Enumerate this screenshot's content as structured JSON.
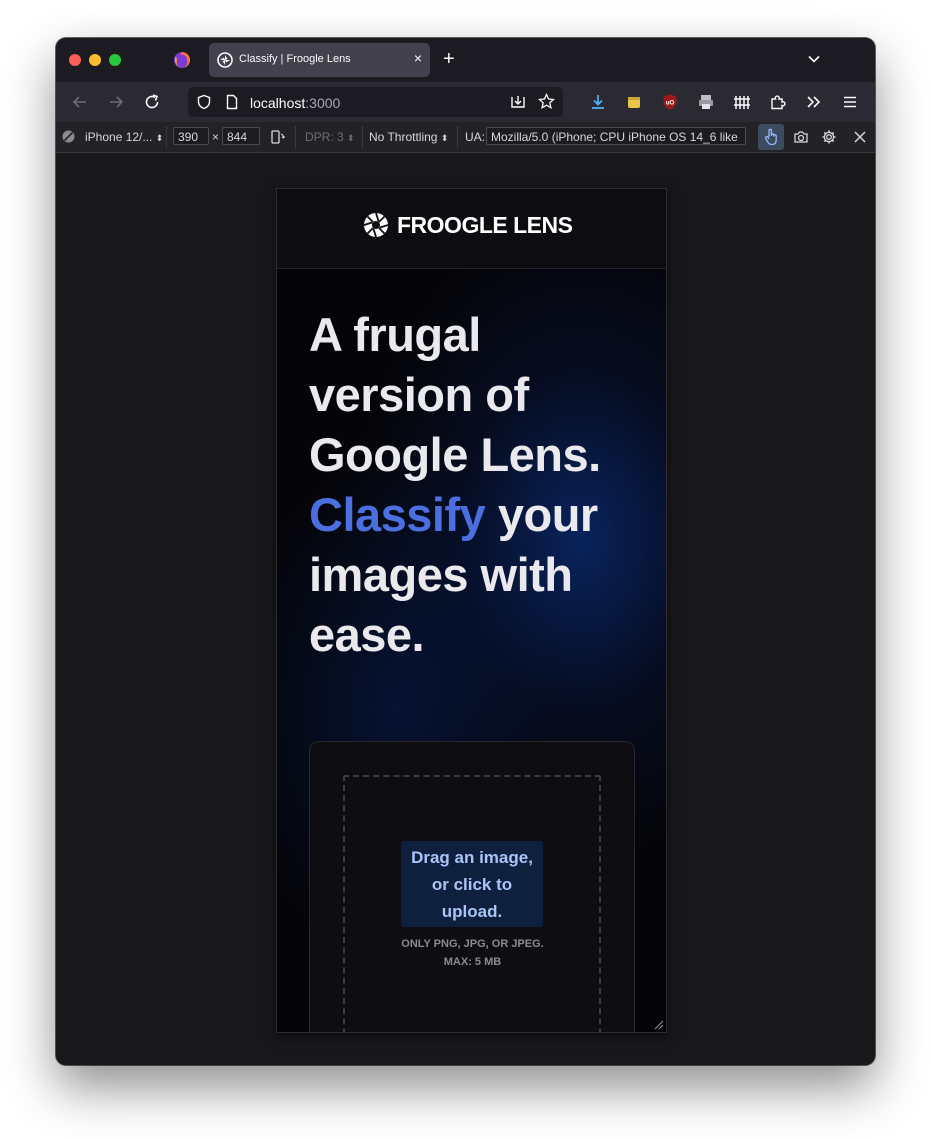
{
  "browser": {
    "tab": {
      "title": "Classify | Froogle Lens"
    },
    "new_tab_symbol": "+",
    "tab_close_symbol": "×",
    "url": {
      "host": "localhost",
      "port": ":3000"
    }
  },
  "responsive_bar": {
    "device": "iPhone 12/...",
    "width": "390",
    "times": "×",
    "height": "844",
    "dpr": "DPR: 3",
    "throttling": "No Throttling",
    "ua_label": "UA:",
    "user_agent": "Mozilla/5.0 (iPhone; CPU iPhone OS 14_6 like"
  },
  "site": {
    "logo_text": "FROOGLE LENS",
    "headline": {
      "part1": "A frugal version of Google Lens. ",
      "accent": "Classify",
      "part2": " your images with ease."
    },
    "upload": {
      "button": "Drag an image, or click to upload.",
      "hint": "ONLY PNG, JPG, OR JPEG. MAX: 5 MB"
    }
  },
  "colors": {
    "accent": "#4c6fe0",
    "background": "#050509"
  }
}
